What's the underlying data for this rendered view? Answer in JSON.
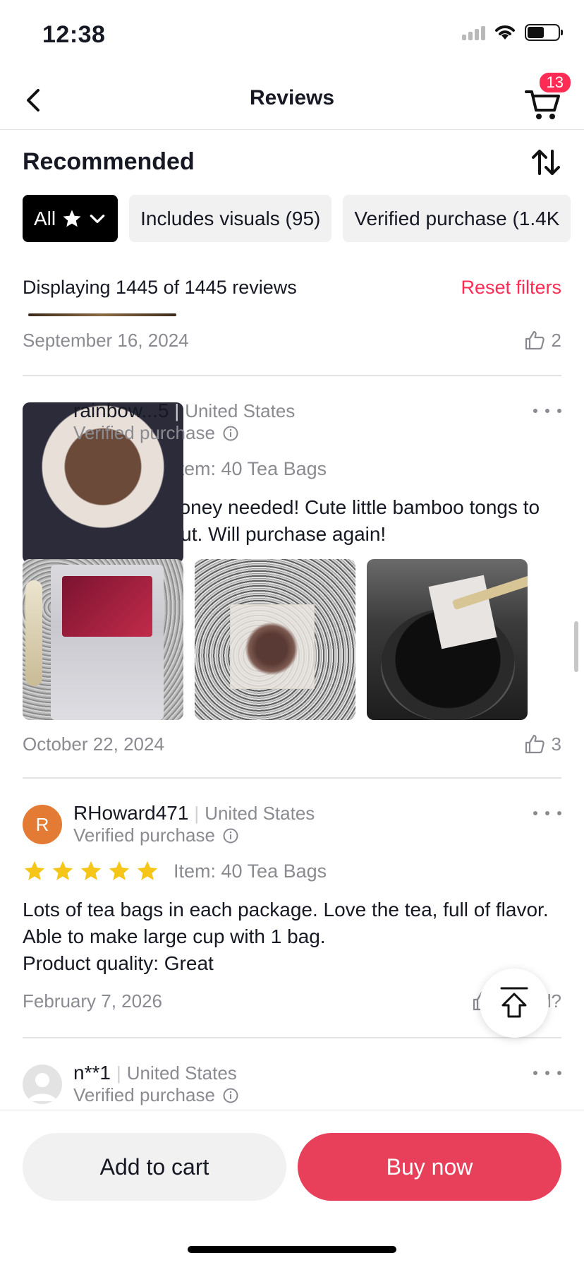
{
  "status_bar": {
    "time": "12:38"
  },
  "nav": {
    "title": "Reviews",
    "cart_count": "13"
  },
  "section": {
    "title": "Recommended"
  },
  "filters": {
    "all_label": "All",
    "chips": [
      "Includes visuals (95)",
      "Verified purchase (1.4K"
    ]
  },
  "summary": {
    "displaying": "Displaying 1445 of 1445 reviews",
    "reset": "Reset filters"
  },
  "prev_review": {
    "date": "September 16, 2024",
    "likes": "2"
  },
  "reviews": [
    {
      "username": "rainbow...5",
      "country": "United States",
      "verified": "Verified purchase",
      "rating": 5,
      "item": "Item: 40 Tea Bags",
      "text": "Love it as is! No honey needed! Cute little bamboo tongs to take the tea bag out. Will purchase again!",
      "date": "October 22, 2024",
      "likes": "3"
    },
    {
      "username": "RHoward471",
      "avatar_letter": "R",
      "country": "United States",
      "verified": "Verified purchase",
      "rating": 5,
      "item": "Item: 40 Tea Bags",
      "text_line1": "Lots of tea bags in each package. Love the tea, full of flavor. Able to make large cup with 1 bag.",
      "text_line2": "Product quality: Great",
      "date": "February 7, 2026",
      "helpful_suffix": "l?"
    },
    {
      "username": "n**1",
      "country": "United States",
      "verified": "Verified purchase"
    }
  ],
  "actions": {
    "add_to_cart": "Add to cart",
    "buy_now": "Buy now"
  },
  "colors": {
    "accent": "#fe2c55",
    "buy_button": "#e8405a",
    "star": "#f5c518"
  },
  "icons": [
    "back-icon",
    "cart-icon",
    "sort-icon",
    "star-icon",
    "chevron-down-icon",
    "thumbs-up-icon",
    "info-icon",
    "more-icon",
    "arrow-up-icon"
  ]
}
